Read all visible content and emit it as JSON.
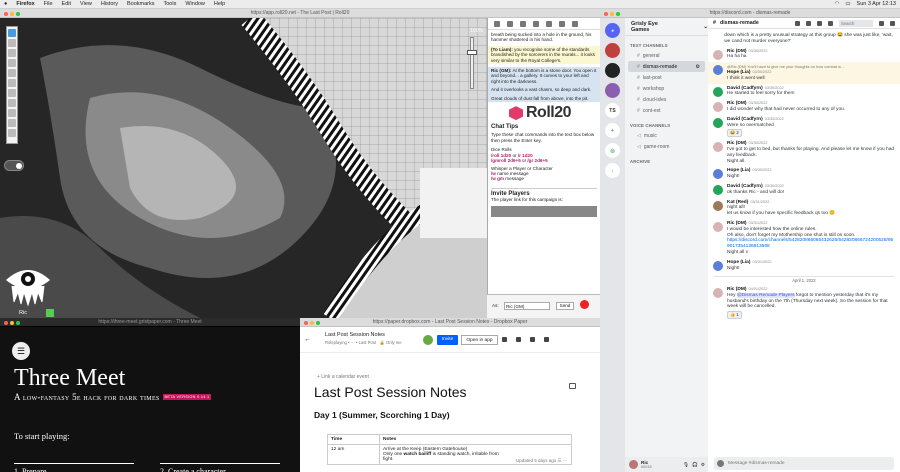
{
  "menubar": {
    "app": "Firefox",
    "items": [
      "File",
      "Edit",
      "View",
      "History",
      "Bookmarks",
      "Tools",
      "Window",
      "Help"
    ],
    "datetime": "Sun 3 Apr  12:13"
  },
  "roll20": {
    "url": "https://app.roll20.net - The Last Post | Roll20",
    "zoom": "100%",
    "token_name": "Ric",
    "chat": {
      "m1": "breath being sucked into a hole in the ground, his hammer shattered in his hand.",
      "m2_who": "(To Liam):",
      "m2": "you recognise some of the standards brandished by the sorcerers in the murals... it looks very similar to the Royal College's.",
      "m3_who": "Ric (GM):",
      "m3": "At the bottom is a stone door. You open it and beyond... a gallery. It curves to your left and right into the darkness.",
      "m3b": "And it overlooks a vast chasm, so deep and dark.",
      "m3c": "Great clouds of dust fall from above, into the pit.",
      "logo": "Roll20",
      "tips_title": "Chat Tips",
      "tips_intro": "Type these chat commands into the text box below then press the Enter key.",
      "tip_dice": "Dice Rolls",
      "tip_dice_cmd1": "/roll 1d20",
      "tip_dice_or1": " or ",
      "tip_dice_cmd2": "/r 1d20",
      "tip_dice_cmd3": "/gmroll 2d6+5",
      "tip_dice_or2": " or ",
      "tip_dice_cmd4": "/gr 2d6+5",
      "tip_whisper": "Whisper a Player or Character",
      "tip_w_cmd": "/w",
      "tip_w_text": " name message",
      "tip_gm_cmd": "/w gm",
      "tip_gm_text": " message",
      "invite_title": "Invite Players",
      "invite_text": "The player link for this campaign is:",
      "as_label": "As:",
      "as_value": "Ric (GM)",
      "send": "Send"
    }
  },
  "threemeet": {
    "url": "https://three-meet.gristpaper.com - Three Meet",
    "menu_icon": "☰",
    "title": "Three Meet",
    "subtitle": "A low-fantasy 5e hack for dark times",
    "beta": "BETA VERSION 0.14.1",
    "start": "To start playing:",
    "link1": "1. Prepare",
    "link2": "2. Create a character"
  },
  "paper": {
    "url": "https://paper.dropbox.com - Last Post Session Notes - Dropbox Paper",
    "doc_title": "Last Post Session Notes",
    "crumb": "Roleplaying  •  ⋯  •  Last Post",
    "owner": "Only me",
    "invite": "Invite",
    "open_app": "Open in app",
    "calendar": "+ Link a calendar event",
    "title": "Last Post Session Notes",
    "heading": "Day 1 (Summer, Scorching 1 Day)",
    "table": {
      "headers": [
        "Time",
        "Notes"
      ],
      "row_time": "12 am",
      "row_note1": "Arrive at the Keep (Eastern Gatehouse)",
      "row_note2a": "Only one ",
      "row_note2b": "watch bailiff",
      "row_note2c": " is standing watch, irritable from",
      "row_note3": "fight."
    },
    "updated": "Updated 5 days ago"
  },
  "discord": {
    "url": "https://discord.com - dismas-remade",
    "guild": "Grisly Eye Games",
    "server_label": "TS",
    "cat_text": "TEXT CHANNELS",
    "channels": [
      "general",
      "dismas-remade",
      "last-post",
      "workshop",
      "cloud-isles",
      "cont-ext"
    ],
    "cat_voice": "VOICE CHANNELS",
    "voice": [
      "music",
      "game-room"
    ],
    "cat_archive": "ARCHIVE",
    "user": "Ric",
    "user_tag": "#0018",
    "channel": "dismas-remade",
    "search": "Search",
    "input_placeholder": "Message #dismas-remade",
    "top_text": "down which is a pretty unusual strategy at this group 😂 she was just like, 'wait, we cand not murder everyone?'",
    "messages": [
      {
        "name": "Ric (DM)",
        "time": "03/30/2022",
        "text": "Ha ha ha"
      },
      {
        "reply": "@Ric (DM) You'll have to give me your thoughts on how combat w...",
        "name": "Hope (Lia)",
        "time": "03/30/2022",
        "text": "I think it went well"
      },
      {
        "name": "David (Cadfyrn)",
        "time": "03/30/2022",
        "text": "He started to feel sorry for them"
      },
      {
        "name": "Ric (DM)",
        "time": "03/30/2022",
        "text": "I did wonder why that had never occurred to any of you."
      },
      {
        "name": "David (Cadfyrn)",
        "time": "03/30/2022",
        "text": "Were so overmatched",
        "react": "😂 2"
      },
      {
        "name": "Ric (DM)",
        "time": "03/30/2022",
        "text": "I've got to get to bed, but thanks for playing. And please let me know if you had any feedback.",
        "text2": "Night all."
      },
      {
        "name": "Hope (Lia)",
        "time": "03/30/2022",
        "text": "Night!"
      },
      {
        "name": "David (Cadfyrn)",
        "time": "03/30/2022",
        "text": "ok thanks Ric - and will do!"
      },
      {
        "name": "Kat (Red)",
        "time": "03/31/2022",
        "text": "night all!",
        "text2": "let us know if you have specific feedback qs too 😊"
      },
      {
        "name": "Ric (DM)",
        "time": "03/31/2022",
        "text": "I would be interested how the online rules.",
        "text2": "Oh also, don't forget my Mothership one shot is still on soon.",
        "link": "https://discord.com/channels/542820866065432626/542820866724200528/959017354136813568",
        "text3": "Night all x"
      },
      {
        "name": "Hope (Lia)",
        "time": "03/31/2022",
        "text": "Night!"
      }
    ],
    "date_sep": "April 1, 2022",
    "last": {
      "name": "Ric (DM)",
      "time": "04/01/2022",
      "pre": "Hey ",
      "mention": "@Dismas Remade Players",
      "post": " forgot to mention yesterday that it's my husband's birthday on the 7th (Thursday next week). So the session for that week will be cancelled.",
      "react": "👍 1"
    }
  }
}
